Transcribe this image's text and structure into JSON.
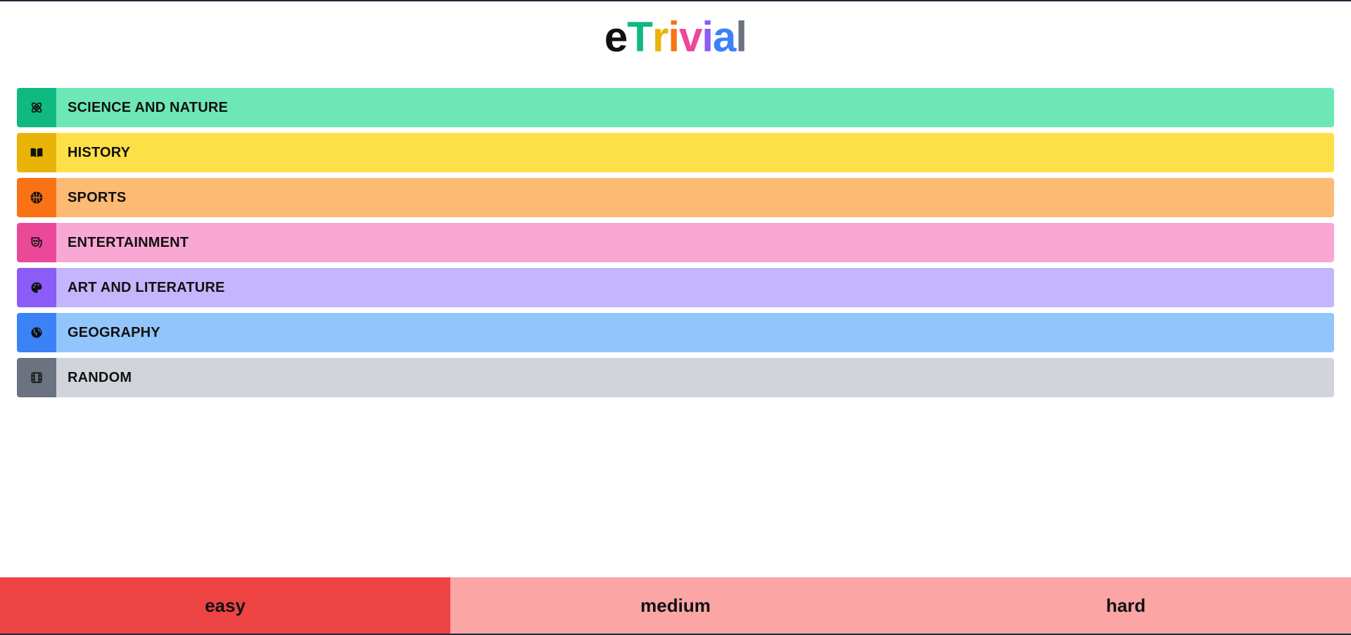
{
  "logo": {
    "letters": [
      {
        "char": "e",
        "color": "#111111"
      },
      {
        "char": "T",
        "color": "#10b981"
      },
      {
        "char": "r",
        "color": "#eab308"
      },
      {
        "char": "i",
        "color": "#f97316"
      },
      {
        "char": "v",
        "color": "#ec4899"
      },
      {
        "char": "i",
        "color": "#8b5cf6"
      },
      {
        "char": "a",
        "color": "#3b82f6"
      },
      {
        "char": "l",
        "color": "#6b7280"
      }
    ]
  },
  "categories": [
    {
      "label": "SCIENCE AND NATURE",
      "icon": "atom-icon",
      "icon_bg": "#10b981",
      "bg": "#6ee7b7"
    },
    {
      "label": "HISTORY",
      "icon": "book-icon",
      "icon_bg": "#eab308",
      "bg": "#fde047"
    },
    {
      "label": "SPORTS",
      "icon": "basketball-icon",
      "icon_bg": "#f97316",
      "bg": "#fdba74"
    },
    {
      "label": "ENTERTAINMENT",
      "icon": "theater-mask-icon",
      "icon_bg": "#ec4899",
      "bg": "#f9a8d4"
    },
    {
      "label": "ART AND LITERATURE",
      "icon": "palette-icon",
      "icon_bg": "#8b5cf6",
      "bg": "#c4b5fd"
    },
    {
      "label": "GEOGRAPHY",
      "icon": "globe-icon",
      "icon_bg": "#3b82f6",
      "bg": "#93c5fd"
    },
    {
      "label": "RANDOM",
      "icon": "film-icon",
      "icon_bg": "#6b7280",
      "bg": "#d1d5db"
    }
  ],
  "difficulty": {
    "options": [
      {
        "label": "easy",
        "selected": true,
        "bg": "#ef4444"
      },
      {
        "label": "medium",
        "selected": false,
        "bg": "#fca5a5"
      },
      {
        "label": "hard",
        "selected": false,
        "bg": "#fca5a5"
      }
    ]
  }
}
